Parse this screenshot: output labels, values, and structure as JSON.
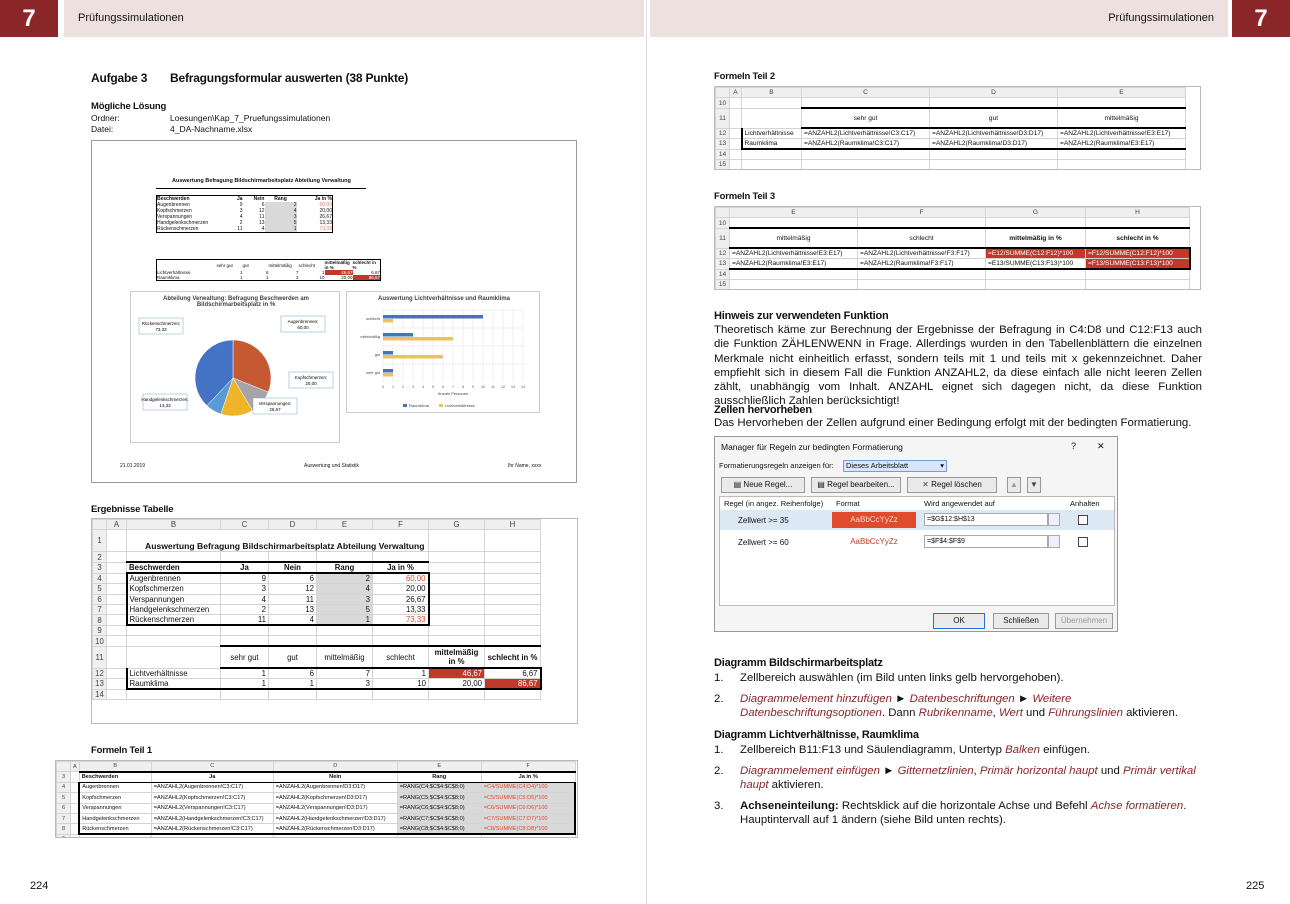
{
  "left": {
    "chapter": "7",
    "header": "Prüfungssimulationen",
    "page": "224",
    "task_no": "Aufgabe 3",
    "task_title": "Befragungsformular auswerten (38 Punkte)",
    "solution": "Mögliche Lösung",
    "folder_label": "Ordner:",
    "folder": "Loesungen\\Kap_7_Pruefungssimulationen",
    "file_label": "Datei:",
    "file": "4_DA-Nachname.xlsx",
    "preview": {
      "title": "Auswertung Befragung Bildschirmarbeitsplatz Abteilung Verwaltung",
      "pie_title": "Abteilung Verwaltung: Befragung Beschwerden am Bildschirmarbeitsplatz in %",
      "bar_title": "Auswertung Lichtverhältnisse und Raumklima",
      "pie_labels": [
        "Rückenschmerzen; 73,33",
        "Augenbrennen; 60,00",
        "Kopfschmerzen; 20,00",
        "Verspannungen; 26,67",
        "Handgelenkschmerzen; 13,33"
      ],
      "bar_cats": [
        "schlecht",
        "mittelmäßig",
        "gut",
        "sehr gut"
      ],
      "bar_axis": [
        "0",
        "1",
        "2",
        "3",
        "4",
        "5",
        "6",
        "7",
        "8",
        "9",
        "10",
        "11",
        "12",
        "13",
        "14"
      ],
      "bar_xlabel": "Anzahl Personen",
      "legend": [
        "Raumklima",
        "Lichtverhältnisse"
      ],
      "footer_date": "21.01.2019",
      "footer_mid": "Auswertung und Statistik",
      "footer_right": "Ihr Name, xxxx"
    },
    "results_heading": "Ergebnisse Tabelle",
    "formulas1_heading": "Formeln Teil 1"
  },
  "right": {
    "chapter": "7",
    "header": "Prüfungssimulationen",
    "page": "225",
    "formulas2_heading": "Formeln Teil 2",
    "formulas3_heading": "Formeln Teil 3",
    "hint_heading": "Hinweis zur verwendeten Funktion",
    "hint_text": "Theoretisch käme zur Berechnung der Ergebnisse der Befragung in C4:D8 und C12:F13 auch die Funktion ZÄHLENWENN in Frage. Allerdings wurden in den Tabellenblättern die einzelnen Merkmale nicht einheitlich erfasst, sondern teils mit 1 und teils mit x gekennzeichnet. Daher empfiehlt sich in diesem Fall die Funktion ANZAHL2, da diese einfach alle nicht leeren Zellen zählt, unabhängig vom Inhalt. ANZAHL eignet sich dagegen nicht, da diese Funktion ausschließlich Zahlen berücksichtigt!",
    "highlight_heading": "Zellen hervorheben",
    "highlight_text": "Das Hervorheben der Zellen aufgrund einer Bedingung erfolgt mit der bedingten Formatierung.",
    "dialog": {
      "title": "Manager für Regeln zur bedingten Formatierung",
      "help": "?",
      "close": "✕",
      "show_label": "Formatierungsregeln anzeigen für:",
      "show_value": "Dieses Arbeitsblatt",
      "new": "Neue Regel...",
      "edit": "Regel bearbeiten...",
      "delete": "Regel löschen",
      "col_rule": "Regel (in angez. Reihenfolge)",
      "col_format": "Format",
      "col_applies": "Wird angewendet auf",
      "col_stop": "Anhalten",
      "rules": [
        {
          "rule": "Zellwert >= 35",
          "format": "AaBbCcYyZz",
          "applies": "=$G$12:$H$13"
        },
        {
          "rule": "Zellwert >= 60",
          "format": "AaBbCcYyZz",
          "applies": "=$F$4:$F$9"
        }
      ],
      "ok": "OK",
      "close_btn": "Schließen",
      "apply": "Übernehmen"
    },
    "chart1_heading": "Diagramm Bildschirmarbeitsplatz",
    "chart1_steps": [
      "1.",
      "Zellbereich auswählen (im Bild unten links gelb hervorgehoben).",
      "2.",
      "Diagrammelement hinzufügen",
      "►",
      "Datenbeschriftungen",
      "►",
      "Weitere Datenbeschriftungsoptionen",
      ". Dann ",
      "Rubrikenname",
      ", ",
      "Wert",
      " und ",
      "Führungslinien",
      " aktivieren."
    ],
    "chart2_heading": "Diagramm Lichtverhältnisse, Raumklima",
    "chart2_s1": "Zellbereich B11:F13 und Säulendiagramm, Untertyp ",
    "chart2_s1b": "Balken",
    " chart2_s1c": " einfügen.",
    "chart2_s2a": "Diagrammelement einfügen",
    "chart2_s2b": "►",
    "chart2_s2c": "Gitternetzlinien",
    "chart2_s2d": ", ",
    "chart2_s2e": "Primär horizontal haupt",
    "chart2_s2f": " und ",
    "chart2_s2g": "Primär vertikal haupt",
    "chart2_s2h": " aktivieren.",
    "chart2_s3a": "Achseneinteilung:",
    "chart2_s3b": " Rechtsklick auf die horizontale Achse und Befehl ",
    "chart2_s3c": "Achse formatieren",
    "chart2_s3d": ". Hauptintervall auf 1 ändern (siehe Bild unten rechts)."
  },
  "sheet": {
    "title": "Auswertung Befragung Bildschirmarbeitsplatz Abteilung Verwaltung",
    "cols": [
      "A",
      "B",
      "C",
      "D",
      "E",
      "F",
      "G",
      "H"
    ],
    "head": [
      "Beschwerden",
      "Ja",
      "Nein",
      "Rang",
      "Ja in %"
    ],
    "rows": [
      [
        "Augenbrennen",
        "9",
        "6",
        "2",
        "60,00"
      ],
      [
        "Kopfschmerzen",
        "3",
        "12",
        "4",
        "20,00"
      ],
      [
        "Verspannungen",
        "4",
        "11",
        "3",
        "26,67"
      ],
      [
        "Handgelenkschmerzen",
        "2",
        "13",
        "5",
        "13,33"
      ],
      [
        "Rückenschmerzen",
        "11",
        "4",
        "1",
        "73,33"
      ]
    ],
    "head2": [
      "sehr gut",
      "gut",
      "mittelmäßig",
      "schlecht",
      "mittelmäßig in %",
      "schlecht in %"
    ],
    "rows2": [
      [
        "Lichtverhältnisse",
        "1",
        "6",
        "7",
        "1",
        "46,67",
        "6,67"
      ],
      [
        "Raumklima",
        "1",
        "1",
        "3",
        "10",
        "20,00",
        "86,67"
      ]
    ]
  },
  "f1": {
    "cols": [
      "B",
      "C",
      "D",
      "E",
      "F"
    ],
    "head": [
      "Beschwerden",
      "Ja",
      "Nein",
      "Rang",
      "Ja in %"
    ],
    "rows": [
      [
        "Augenbrennen",
        "=ANZAHL2(Augenbrennen!C3:C17)",
        "=ANZAHL2(Augenbrennen!D3:D17)",
        "=RANG(C4;$C$4:$C$8;0)",
        "=C4/SUMME(C4:D4)*100"
      ],
      [
        "Kopfschmerzen",
        "=ANZAHL2(Kopfschmerzen!C3:C17)",
        "=ANZAHL2(Kopfschmerzen!D3:D17)",
        "=RANG(C5;$C$4:$C$8;0)",
        "=C5/SUMME(C5:D5)*100"
      ],
      [
        "Verspannungen",
        "=ANZAHL2(Verspannungen!C3:C17)",
        "=ANZAHL2(Verspannungen!D3:D17)",
        "=RANG(C6;$C$4:$C$8;0)",
        "=C6/SUMME(C6:D6)*100"
      ],
      [
        "Handgelenkschmerzen",
        "=ANZAHL2(Handgelenkschmerzen!C3:C17)",
        "=ANZAHL2(Handgelenkschmerzen!D3:D17)",
        "=RANG(C7;$C$4:$C$8;0)",
        "=C7/SUMME(C7:D7)*100"
      ],
      [
        "Rückenschmerzen",
        "=ANZAHL2(Rückenschmerzen!C3:C17)",
        "=ANZAHL2(Rückenschmerzen!D3:D17)",
        "=RANG(C8;$C$4:$C$8;0)",
        "=C8/SUMME(C8:D8)*100"
      ]
    ]
  },
  "f2": {
    "cols": [
      "A",
      "B",
      "C",
      "D",
      "E"
    ],
    "head": [
      "sehr gut",
      "gut",
      "mittelmäßig"
    ],
    "rows": [
      [
        "Lichtverhältnisse",
        "=ANZAHL2(Lichtverhältnisse!C3:C17)",
        "=ANZAHL2(Lichtverhältnisse!D3:D17)",
        "=ANZAHL2(Lichtverhältnisse!E3:E17)"
      ],
      [
        "Raumklima",
        "=ANZAHL2(Raumklima!C3:C17)",
        "=ANZAHL2(Raumklima!D3:D17)",
        "=ANZAHL2(Raumklima!E3:E17)"
      ]
    ]
  },
  "f3": {
    "cols": [
      "E",
      "F",
      "G",
      "H"
    ],
    "head": [
      "mittelmäßig",
      "schlecht",
      "mittelmäßig in %",
      "schlecht in %"
    ],
    "rows": [
      [
        "=ANZAHL2(Lichtverhältnisse!E3:E17)",
        "=ANZAHL2(Lichtverhältnisse!F3:F17)",
        "=E12/SUMME(C12:F12)*100",
        "=F12/SUMME(C12:F12)*100"
      ],
      [
        "=ANZAHL2(Raumklima!E3:E17)",
        "=ANZAHL2(Raumklima!F3:F17)",
        "=E13/SUMME(C13:F13)*100",
        "=F13/SUMME(C13:F13)*100"
      ]
    ]
  }
}
